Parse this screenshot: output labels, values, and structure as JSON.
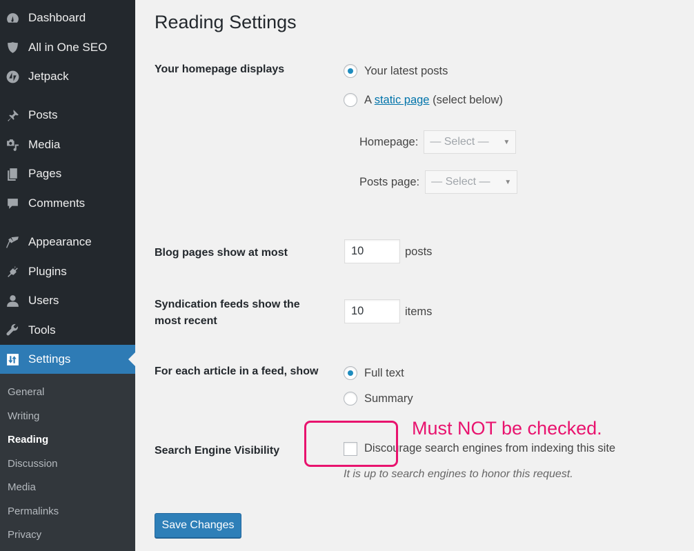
{
  "sidebar": {
    "items": [
      {
        "label": "Dashboard",
        "icon": "dashboard-icon"
      },
      {
        "label": "All in One SEO",
        "icon": "shield-icon"
      },
      {
        "label": "Jetpack",
        "icon": "jetpack-icon"
      },
      {
        "label": "Posts",
        "icon": "pushpin-icon"
      },
      {
        "label": "Media",
        "icon": "media-icon"
      },
      {
        "label": "Pages",
        "icon": "pages-icon"
      },
      {
        "label": "Comments",
        "icon": "comment-icon"
      },
      {
        "label": "Appearance",
        "icon": "paintbrush-icon"
      },
      {
        "label": "Plugins",
        "icon": "plug-icon"
      },
      {
        "label": "Users",
        "icon": "user-icon"
      },
      {
        "label": "Tools",
        "icon": "wrench-icon"
      },
      {
        "label": "Settings",
        "icon": "settings-sliders-icon",
        "active": true
      }
    ],
    "submenu": [
      {
        "label": "General"
      },
      {
        "label": "Writing"
      },
      {
        "label": "Reading",
        "current": true
      },
      {
        "label": "Discussion"
      },
      {
        "label": "Media"
      },
      {
        "label": "Permalinks"
      },
      {
        "label": "Privacy"
      }
    ]
  },
  "page": {
    "title": "Reading Settings",
    "homepage_displays": {
      "label": "Your homepage displays",
      "options": [
        {
          "label": "Your latest posts",
          "checked": true
        },
        {
          "prefix": "A ",
          "link": "static page",
          "suffix": " (select below)",
          "checked": false
        }
      ],
      "homepage_select": {
        "label": "Homepage:",
        "value": "— Select —"
      },
      "posts_page_select": {
        "label": "Posts page:",
        "value": "— Select —"
      }
    },
    "blog_pages": {
      "label": "Blog pages show at most",
      "value": "10",
      "suffix": "posts"
    },
    "syndication": {
      "label_line1": "Syndication feeds show the",
      "label_line2": "most recent",
      "value": "10",
      "suffix": "items"
    },
    "feed_article": {
      "label": "For each article in a feed, show",
      "options": [
        {
          "label": "Full text",
          "checked": true
        },
        {
          "label": "Summary",
          "checked": false
        }
      ]
    },
    "search_visibility": {
      "label": "Search Engine Visibility",
      "checkbox_label": "Discourage search engines from indexing this site",
      "checked": false,
      "description": "It is up to search engines to honor this request."
    },
    "annotation": {
      "text": "Must NOT be checked.",
      "color": "#e8136e"
    },
    "save_button": "Save Changes"
  },
  "colors": {
    "accent": "#2e7bb5",
    "sidebar_bg": "#23282d",
    "submenu_bg": "#32373c",
    "link": "#0073aa"
  }
}
